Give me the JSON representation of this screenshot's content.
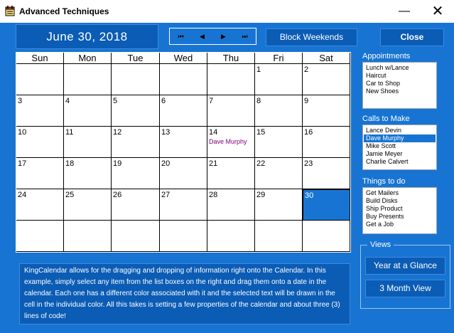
{
  "window": {
    "title": "Advanced Techniques",
    "minimize_glyph": "—",
    "close_glyph": "✕"
  },
  "header": {
    "date": "June 30, 2018",
    "nav_buttons": [
      "⏮",
      "◀",
      "▶",
      "⏭"
    ],
    "block_weekends": "Block Weekends",
    "close": "Close"
  },
  "calendar": {
    "days": [
      "Sun",
      "Mon",
      "Tue",
      "Wed",
      "Thu",
      "Fri",
      "Sat"
    ],
    "weeks": [
      [
        "",
        "",
        "",
        "",
        "",
        "1",
        "2"
      ],
      [
        "3",
        "4",
        "5",
        "6",
        "7",
        "8",
        "9"
      ],
      [
        "10",
        "11",
        "12",
        "13",
        "14",
        "15",
        "16"
      ],
      [
        "17",
        "18",
        "19",
        "20",
        "21",
        "22",
        "23"
      ],
      [
        "24",
        "25",
        "26",
        "27",
        "28",
        "29",
        "30"
      ],
      [
        "",
        "",
        "",
        "",
        "",
        "",
        ""
      ]
    ],
    "selected_day": "30",
    "note": {
      "day": "14",
      "text": "Dave Murphy",
      "color": "#800080"
    }
  },
  "appointments": {
    "label": "Appointments",
    "items": [
      "Lunch w/Lance",
      "Haircut",
      "Car to Shop",
      "New Shoes"
    ]
  },
  "calls": {
    "label": "Calls to Make",
    "items": [
      "Lance Devin",
      "Dave Murphy",
      "Mike Scott",
      "Jamie Meyer",
      "Charlie Calvert"
    ],
    "selected": "Dave Murphy"
  },
  "things": {
    "label": "Things to do",
    "items": [
      "Get Mailers",
      "Build Disks",
      "Ship Product",
      "Buy Presents",
      "Get a Job"
    ]
  },
  "views": {
    "label": "Views",
    "year_button": "Year at a Glance",
    "month_button": "3 Month View"
  },
  "description": "KingCalendar allows for the dragging and dropping of information right onto the Calendar. In this example, simply select any item from the list boxes on the right and drag them onto a date in the calendar. Each one has a different color associated with it and the selected text will be drawn in the cell in the individual color. All this takes is setting a few properties of the calendar and about three (3) lines of code!",
  "colors": {
    "window_bg": "#1874d2",
    "panel_dark": "#0b5cb5",
    "selection": "#1874d2",
    "note_color": "#800080"
  },
  "icons": {
    "app": "calendar-app-icon"
  }
}
